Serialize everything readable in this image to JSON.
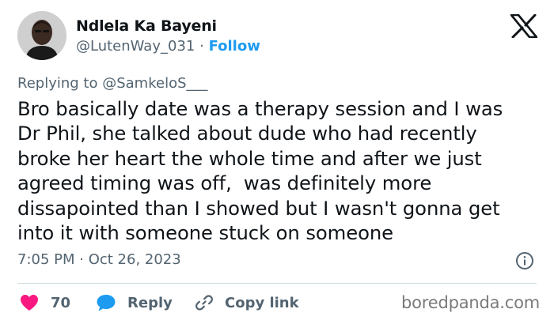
{
  "author": {
    "display_name": "Ndlela Ka Bayeni",
    "handle": "@LutenWay_031",
    "separator": "·",
    "follow_label": "Follow"
  },
  "reply_context": {
    "prefix": "Replying to",
    "mention": "@SamkeloS___"
  },
  "tweet": {
    "text": "Bro basically date was a therapy session and I was\nDr Phil, she talked about dude who had recently\nbroke her heart the whole time and after we just\nagreed timing was off,  was definitely more\ndissapointed than I showed but I wasn't gonna get\ninto it with someone stuck on someone",
    "timestamp": "7:05 PM · Oct 26, 2023"
  },
  "actions": {
    "like_count": "70",
    "reply_label": "Reply",
    "copy_link_label": "Copy link"
  },
  "watermark": "boredpanda.com",
  "icons": {
    "logo": "x-logo-icon",
    "info": "info-icon",
    "like": "heart-icon",
    "reply": "speech-bubble-icon",
    "copy": "link-icon"
  },
  "colors": {
    "accent": "#1d9bf0",
    "like": "#f91880",
    "muted_text": "#536471",
    "text": "#0f1419"
  }
}
